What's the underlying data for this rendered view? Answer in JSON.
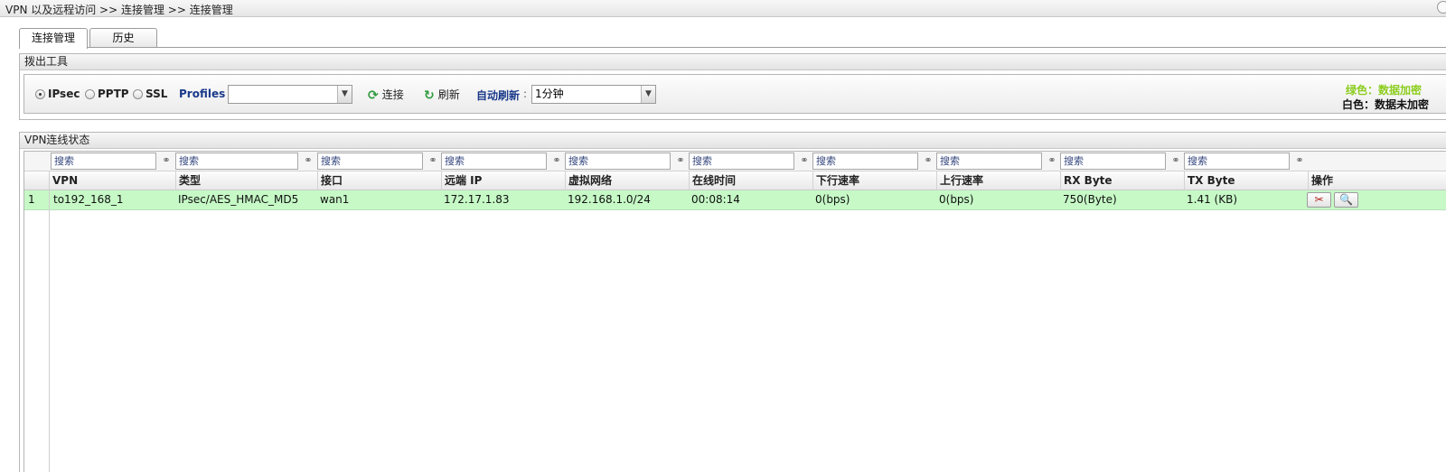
{
  "breadcrumb": "VPN 以及远程访问 >> 连接管理 >> 连接管理",
  "tabs": [
    {
      "label": "连接管理",
      "active": true
    },
    {
      "label": "历史",
      "active": false
    }
  ],
  "dial_panel": {
    "title": "拨出工具",
    "radios": [
      {
        "label": "IPsec",
        "checked": true
      },
      {
        "label": "PPTP",
        "checked": false
      },
      {
        "label": "SSL",
        "checked": false
      }
    ],
    "profiles_label": "Profiles :",
    "profiles_value": "",
    "connect_label": "连接",
    "refresh_label": "刷新",
    "auto_refresh_label": "自动刷新",
    "auto_refresh_colon": ":",
    "auto_refresh_value": "1分钟",
    "legend_green": "绿色：数据加密",
    "legend_white": "白色：数据未加密",
    "legend_green_color": "#8ccd1e"
  },
  "status_panel": {
    "title": "VPN连线状态",
    "search_placeholder": "搜索",
    "columns": [
      "VPN",
      "类型",
      "接口",
      "远端 IP",
      "虚拟网络",
      "在线时间",
      "下行速率",
      "上行速率",
      "RX Byte",
      "TX Byte",
      "操作"
    ],
    "rows": [
      {
        "index": "1",
        "cells": [
          "to192_168_1",
          "IPsec/AES_HMAC_MD5",
          "wan1",
          "172.17.1.83",
          "192.168.1.0/24",
          "00:08:14",
          "0(bps)",
          "0(bps)",
          "750(Byte)",
          "1.41 (KB)"
        ],
        "row_color": "#c6f9c6"
      }
    ],
    "action_icons": [
      "disconnect-icon",
      "detail-icon"
    ]
  }
}
